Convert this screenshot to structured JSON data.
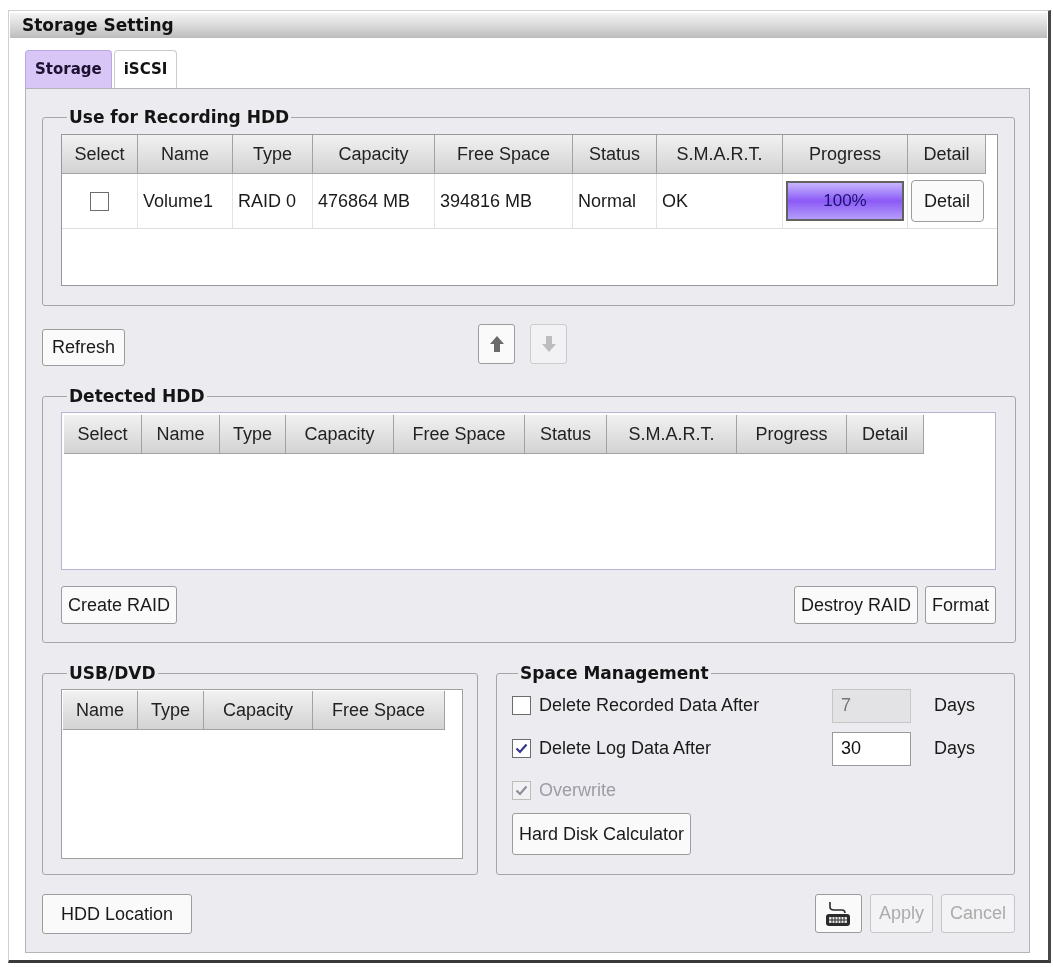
{
  "window": {
    "title": "Storage Setting"
  },
  "tabs": [
    {
      "label": "Storage",
      "selected": true
    },
    {
      "label": "iSCSI",
      "selected": false
    }
  ],
  "recording_hdd": {
    "title": "Use for Recording HDD",
    "columns": [
      "Select",
      "Name",
      "Type",
      "Capacity",
      "Free Space",
      "Status",
      "S.M.A.R.T.",
      "Progress",
      "Detail"
    ],
    "rows": [
      {
        "cells": [
          {
            "kind": "checkbox",
            "checked": false
          },
          {
            "kind": "text",
            "text": "Volume1"
          },
          {
            "kind": "text",
            "text": "RAID 0"
          },
          {
            "kind": "text",
            "text": "476864 MB"
          },
          {
            "kind": "text",
            "text": "394816 MB"
          },
          {
            "kind": "text",
            "text": "Normal"
          },
          {
            "kind": "text",
            "text": "OK"
          },
          {
            "kind": "progress",
            "level": 1,
            "label": "100%"
          },
          {
            "kind": "button",
            "label": "Detail"
          }
        ]
      }
    ]
  },
  "refresh_button": "Refresh",
  "move_buttons": [
    {
      "kind": "up",
      "disabled": false
    },
    {
      "kind": "down",
      "disabled": true
    }
  ],
  "detected_hdd": {
    "title": "Detected HDD",
    "columns": [
      "Select",
      "Name",
      "Type",
      "Capacity",
      "Free Space",
      "Status",
      "S.M.A.R.T.",
      "Progress",
      "Detail"
    ],
    "left_buttons": [
      "Create RAID"
    ],
    "right_buttons": [
      "Destroy RAID",
      "Format"
    ]
  },
  "usb_dvd": {
    "title": "USB/DVD",
    "columns": [
      "Name",
      "Type",
      "Capacity",
      "Free Space"
    ]
  },
  "space_management": {
    "title": "Space Management",
    "options": [
      {
        "kind": "days",
        "label": "Delete Recorded Data After",
        "checked": false,
        "disabled": false,
        "field": {
          "value": "7",
          "disabled": true
        },
        "unit": "Days"
      },
      {
        "kind": "days",
        "label": "Delete Log Data After",
        "checked": true,
        "disabled": false,
        "field": {
          "value": "30",
          "disabled": false
        },
        "unit": "Days"
      },
      {
        "kind": "plain",
        "label": "Overwrite",
        "checked": true,
        "disabled": true
      }
    ],
    "calculator_button": "Hard Disk Calculator"
  },
  "footer": {
    "location_button": "HDD Location",
    "buttons": [
      {
        "kind": "keyboard",
        "disabled": false
      },
      {
        "kind": "text",
        "label": "Apply",
        "disabled": true
      },
      {
        "kind": "text",
        "label": "Cancel",
        "disabled": true
      }
    ]
  }
}
